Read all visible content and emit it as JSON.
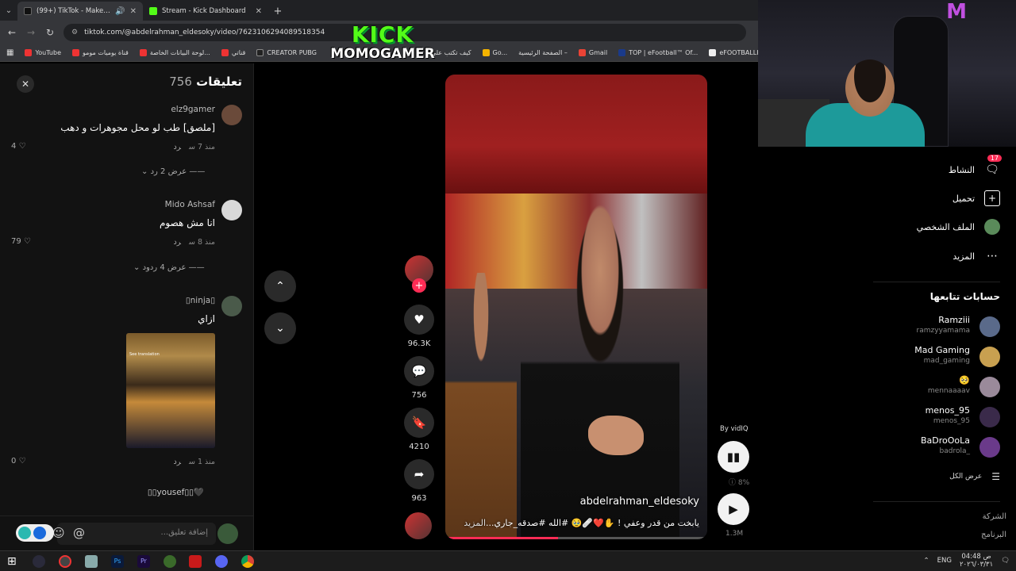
{
  "browser": {
    "tabs": [
      {
        "title": "(99+) TikTok - Make Your Day",
        "active": true,
        "fav_color": "#000000"
      },
      {
        "title": "Stream - Kick Dashboard",
        "active": false,
        "fav_color": "#53fc18"
      }
    ],
    "url": "tiktok.com/@abdelrahman_eldesoky/video/7623106294089518354",
    "bookmarks": [
      "YouTube",
      "قناة يوميات مومو",
      "لوحة البيانات الخاصة...",
      "قناتي",
      "CREATOR PUBG",
      "كيف تكتب على",
      "Go...",
      "الصفحة الرئيسية –",
      "Gmail",
      "TOP | eFootball™ Of...",
      "eFOOTBALLHUB"
    ]
  },
  "overlay": {
    "brand": "KICK",
    "channel": "MOMOGAMER"
  },
  "comments": {
    "title": "تعليقات",
    "count": "756",
    "items": [
      {
        "user": "elz9gamer",
        "text": "[ملصق] طب لو محل مجوهرات و دهب",
        "time": "منذ 7 س",
        "reply": "رد",
        "likes": "4",
        "view_replies": "عرض 2 رد",
        "avatar_color": "#6a4a3a"
      },
      {
        "user": "Mido Ashsaf",
        "text": "انا مش هصوم",
        "time": "منذ 8 س",
        "reply": "رد",
        "likes": "79",
        "view_replies": "عرض 4 ردود",
        "avatar_color": "#d9d9d9"
      },
      {
        "user": "ninja",
        "text": "ازاي",
        "time": "منذ 1 س",
        "reply": "رد",
        "likes": "0",
        "avatar_color": "#4a5a4a"
      },
      {
        "user": "yousef",
        "text": "",
        "avatar_color": "#333333"
      }
    ],
    "image_text": "See translation",
    "input_placeholder": "إضافة تعليق..."
  },
  "video": {
    "username": "abdelrahman_eldesoky",
    "caption": "يابخت من قدر وعفي ! ✋❤️🩹🥹 #الله #صدقه_جاري...",
    "more": "المزيد",
    "progress": 0.43
  },
  "actions": {
    "likes": "96.3K",
    "comments": "756",
    "saves": "4210",
    "shares": "963"
  },
  "vidiq": {
    "label": "By vidIQ",
    "percent": "8%",
    "views": "1.3M"
  },
  "nav": {
    "activity": "النشاط",
    "activity_badge": "17",
    "upload": "تحميل",
    "profile": "الملف الشخصي",
    "more": "المزيد",
    "following_title": "حسابات تتابعها",
    "following": [
      {
        "name": "Ramziii",
        "handle": "ramzyyamama",
        "color": "#5a6a8a"
      },
      {
        "name": "Mad Gaming",
        "handle": "mad_gaming",
        "color": "#c8a050"
      },
      {
        "name": "🥺",
        "handle": "mennaaaav",
        "color": "#9a8a9a"
      },
      {
        "name": "menos_95",
        "handle": "menos_95",
        "color": "#3a2a4a"
      },
      {
        "name": "BaDroOoLa",
        "handle": "badrola_",
        "color": "#6a3a8a"
      }
    ],
    "see_all": "عرض الكل",
    "company": "الشركة",
    "program": "البرنامج"
  },
  "taskbar": {
    "lang": "ENG",
    "time": "04:48 ص",
    "date": "٢٠٢٦/٠٣/٣١"
  }
}
